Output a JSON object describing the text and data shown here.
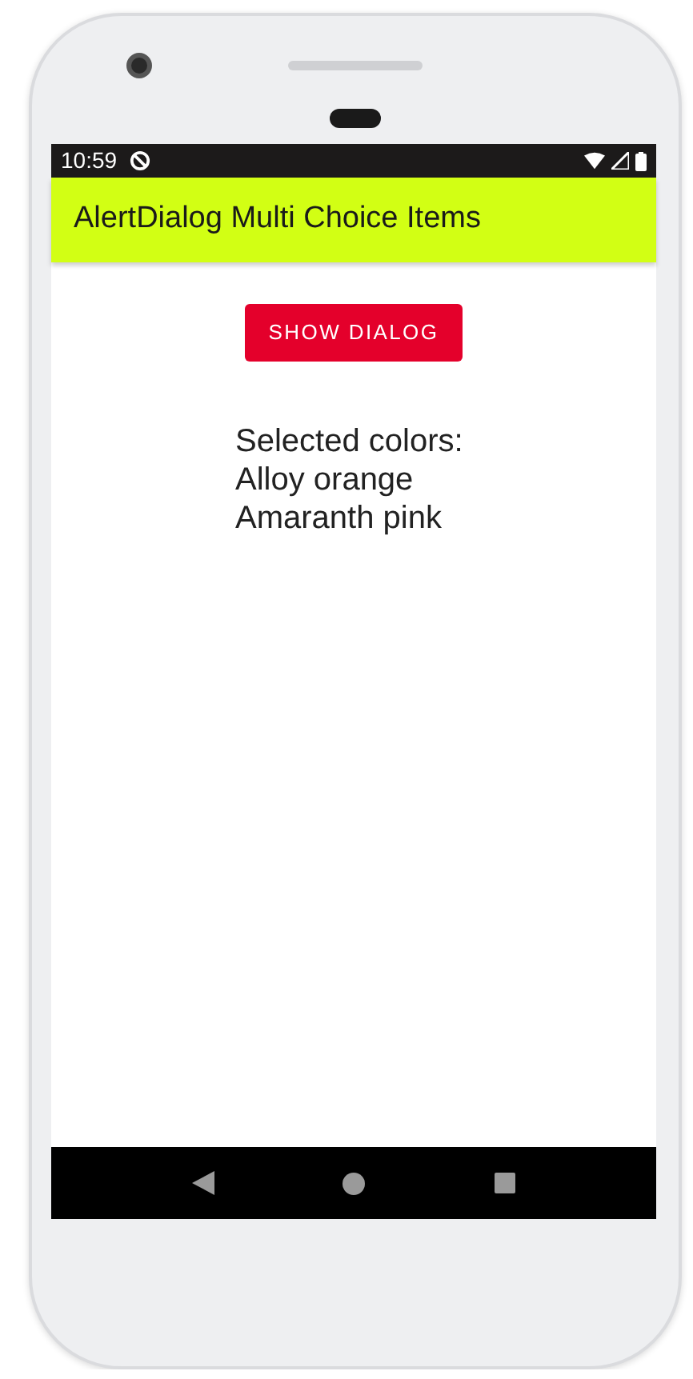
{
  "status_bar": {
    "time": "10:59"
  },
  "app_bar": {
    "title": "AlertDialog Multi Choice Items"
  },
  "button": {
    "label": "SHOW DIALOG"
  },
  "result": {
    "heading": "Selected colors:",
    "items": [
      "Alloy orange",
      "Amaranth pink"
    ]
  }
}
